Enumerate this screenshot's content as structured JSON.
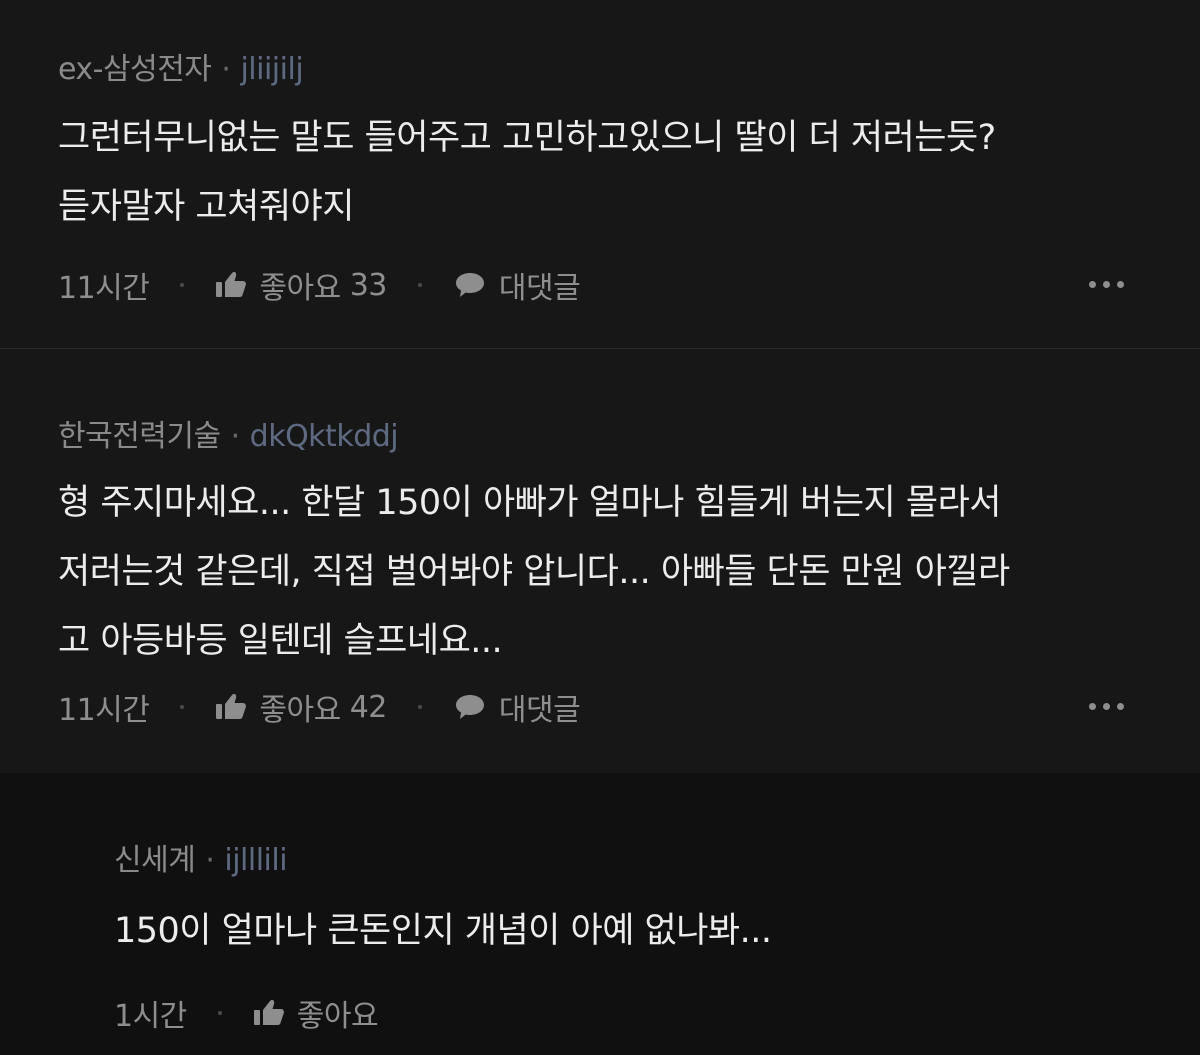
{
  "comments": [
    {
      "company": "ex-삼성전자",
      "nickname": "jliijilj",
      "lines": [
        "그런터무니없는 말도 들어주고 고민하고있으니 딸이 더 저러는듯?",
        "듣자말자 고쳐줘야지"
      ],
      "time": "11시간",
      "like_label": "좋아요",
      "like_count": "33",
      "reply_label": "대댓글"
    },
    {
      "company": "한국전력기술",
      "nickname": "dkQktkddj",
      "lines": [
        "형 주지마세요... 한달 150이 아빠가 얼마나 힘들게 버는지 몰라서",
        "저러는것 같은데, 직접 벌어봐야 압니다... 아빠들 단돈 만원 아낄라",
        "고 아등바등 일텐데 슬프네요..."
      ],
      "time": "11시간",
      "like_label": "좋아요",
      "like_count": "42",
      "reply_label": "대댓글"
    }
  ],
  "reply": {
    "company": "신세계",
    "nickname": "ijlllili",
    "lines": [
      "150이 얼마나 큰돈인지 개념이 아예 없나봐..."
    ],
    "time": "1시간",
    "like_label": "좋아요"
  },
  "separator": "·",
  "icons": {
    "like": "thumbs-up-icon",
    "reply": "speech-bubble-icon",
    "more": "more-dots-icon"
  },
  "colors": {
    "background": "#171717",
    "reply_background": "#101010",
    "text": "#ececec",
    "meta": "#8a8a8a",
    "nickname": "#5f6a82"
  }
}
